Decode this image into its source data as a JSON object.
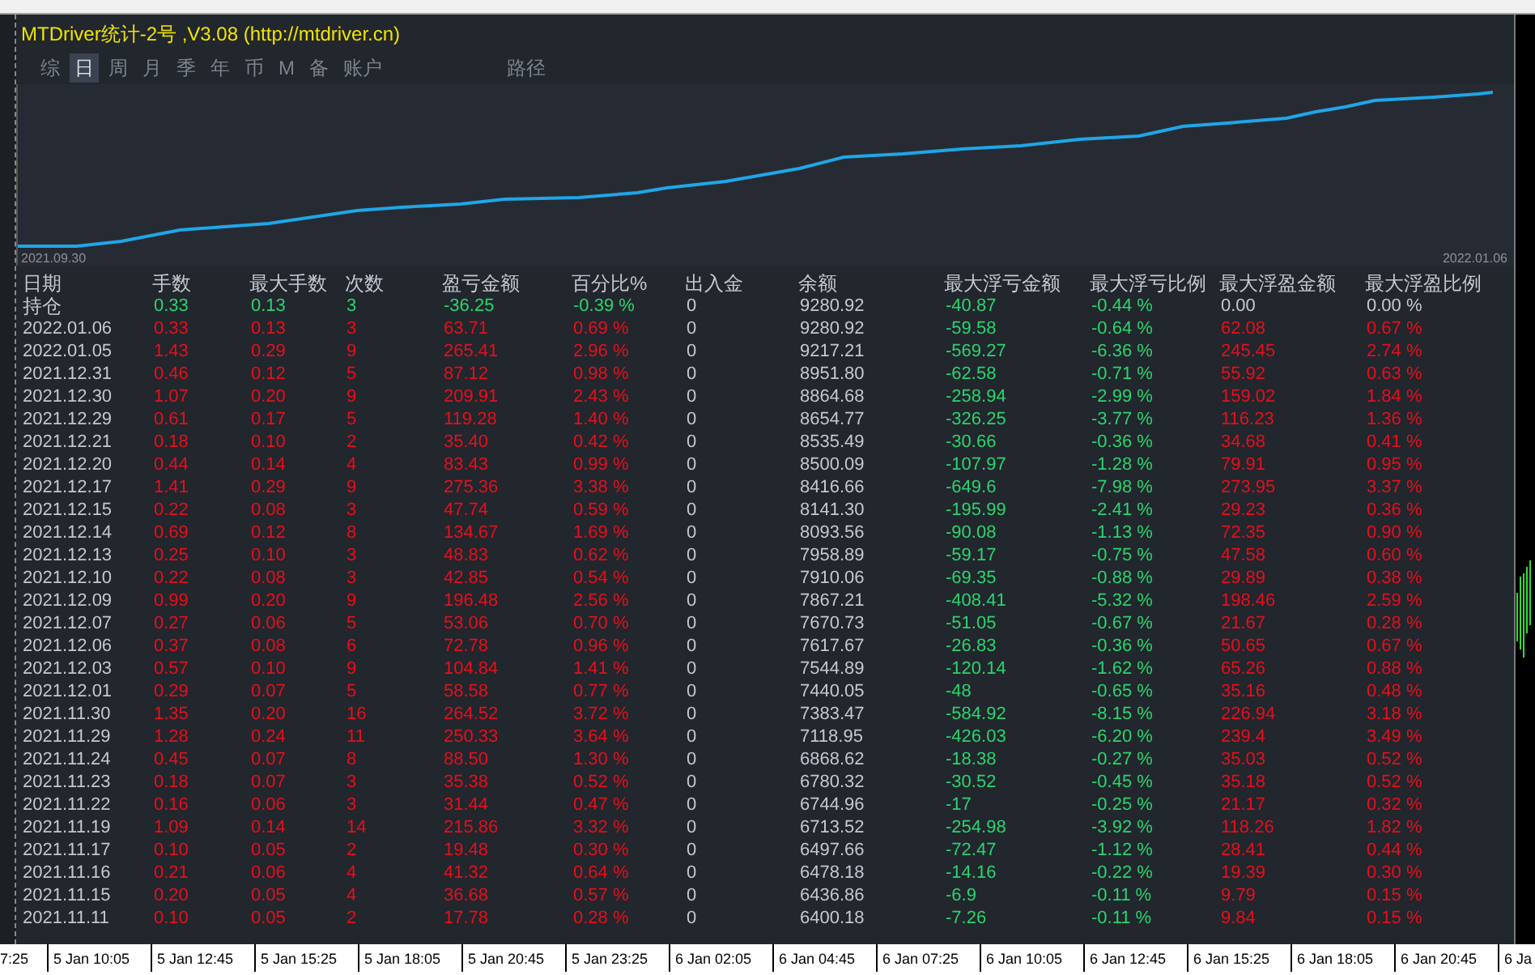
{
  "window": {
    "title": "MTDriver统计-2号 ,V3.08 (http://mtdriver.cn)"
  },
  "tabs": [
    {
      "label": "综",
      "selected": false
    },
    {
      "label": "日",
      "selected": true
    },
    {
      "label": "周",
      "selected": false
    },
    {
      "label": "月",
      "selected": false
    },
    {
      "label": "季",
      "selected": false
    },
    {
      "label": "年",
      "selected": false
    },
    {
      "label": "币",
      "selected": false
    },
    {
      "label": "M",
      "selected": false
    },
    {
      "label": "备",
      "selected": false
    },
    {
      "label": "账户",
      "selected": false
    },
    {
      "label": "路径",
      "selected": false
    }
  ],
  "chart": {
    "start_label": "2021.09.30",
    "end_label": "2022.01.06"
  },
  "table": {
    "columns": [
      "日期",
      "手数",
      "最大手数",
      "次数",
      "盈亏金额",
      "百分比%",
      "出入金",
      "余额",
      "最大浮亏金额",
      "最大浮亏比例",
      "最大浮盈金额",
      "最大浮盈比例"
    ],
    "rows": [
      {
        "kind": "position",
        "cells": [
          "持仓",
          "0.33",
          "0.13",
          "3",
          "-36.25",
          "-0.39 %",
          "0",
          "9280.92",
          "-40.87",
          "-0.44 %",
          "0.00",
          "0.00 %"
        ]
      },
      {
        "kind": "day",
        "cells": [
          "2022.01.06",
          "0.33",
          "0.13",
          "3",
          "63.71",
          "0.69 %",
          "0",
          "9280.92",
          "-59.58",
          "-0.64 %",
          "62.08",
          "0.67 %"
        ]
      },
      {
        "kind": "day",
        "cells": [
          "2022.01.05",
          "1.43",
          "0.29",
          "9",
          "265.41",
          "2.96 %",
          "0",
          "9217.21",
          "-569.27",
          "-6.36 %",
          "245.45",
          "2.74 %"
        ]
      },
      {
        "kind": "day",
        "cells": [
          "2021.12.31",
          "0.46",
          "0.12",
          "5",
          "87.12",
          "0.98 %",
          "0",
          "8951.80",
          "-62.58",
          "-0.71 %",
          "55.92",
          "0.63 %"
        ]
      },
      {
        "kind": "day",
        "cells": [
          "2021.12.30",
          "1.07",
          "0.20",
          "9",
          "209.91",
          "2.43 %",
          "0",
          "8864.68",
          "-258.94",
          "-2.99 %",
          "159.02",
          "1.84 %"
        ]
      },
      {
        "kind": "day",
        "cells": [
          "2021.12.29",
          "0.61",
          "0.17",
          "5",
          "119.28",
          "1.40 %",
          "0",
          "8654.77",
          "-326.25",
          "-3.77 %",
          "116.23",
          "1.36 %"
        ]
      },
      {
        "kind": "day",
        "cells": [
          "2021.12.21",
          "0.18",
          "0.10",
          "2",
          "35.40",
          "0.42 %",
          "0",
          "8535.49",
          "-30.66",
          "-0.36 %",
          "34.68",
          "0.41 %"
        ]
      },
      {
        "kind": "day",
        "cells": [
          "2021.12.20",
          "0.44",
          "0.14",
          "4",
          "83.43",
          "0.99 %",
          "0",
          "8500.09",
          "-107.97",
          "-1.28 %",
          "79.91",
          "0.95 %"
        ]
      },
      {
        "kind": "day",
        "cells": [
          "2021.12.17",
          "1.41",
          "0.29",
          "9",
          "275.36",
          "3.38 %",
          "0",
          "8416.66",
          "-649.6",
          "-7.98 %",
          "273.95",
          "3.37 %"
        ]
      },
      {
        "kind": "day",
        "cells": [
          "2021.12.15",
          "0.22",
          "0.08",
          "3",
          "47.74",
          "0.59 %",
          "0",
          "8141.30",
          "-195.99",
          "-2.41 %",
          "29.23",
          "0.36 %"
        ]
      },
      {
        "kind": "day",
        "cells": [
          "2021.12.14",
          "0.69",
          "0.12",
          "8",
          "134.67",
          "1.69 %",
          "0",
          "8093.56",
          "-90.08",
          "-1.13 %",
          "72.35",
          "0.90 %"
        ]
      },
      {
        "kind": "day",
        "cells": [
          "2021.12.13",
          "0.25",
          "0.10",
          "3",
          "48.83",
          "0.62 %",
          "0",
          "7958.89",
          "-59.17",
          "-0.75 %",
          "47.58",
          "0.60 %"
        ]
      },
      {
        "kind": "day",
        "cells": [
          "2021.12.10",
          "0.22",
          "0.08",
          "3",
          "42.85",
          "0.54 %",
          "0",
          "7910.06",
          "-69.35",
          "-0.88 %",
          "29.89",
          "0.38 %"
        ]
      },
      {
        "kind": "day",
        "cells": [
          "2021.12.09",
          "0.99",
          "0.20",
          "9",
          "196.48",
          "2.56 %",
          "0",
          "7867.21",
          "-408.41",
          "-5.32 %",
          "198.46",
          "2.59 %"
        ]
      },
      {
        "kind": "day",
        "cells": [
          "2021.12.07",
          "0.27",
          "0.06",
          "5",
          "53.06",
          "0.70 %",
          "0",
          "7670.73",
          "-51.05",
          "-0.67 %",
          "21.67",
          "0.28 %"
        ]
      },
      {
        "kind": "day",
        "cells": [
          "2021.12.06",
          "0.37",
          "0.08",
          "6",
          "72.78",
          "0.96 %",
          "0",
          "7617.67",
          "-26.83",
          "-0.36 %",
          "50.65",
          "0.67 %"
        ]
      },
      {
        "kind": "day",
        "cells": [
          "2021.12.03",
          "0.57",
          "0.10",
          "9",
          "104.84",
          "1.41 %",
          "0",
          "7544.89",
          "-120.14",
          "-1.62 %",
          "65.26",
          "0.88 %"
        ]
      },
      {
        "kind": "day",
        "cells": [
          "2021.12.01",
          "0.29",
          "0.07",
          "5",
          "58.58",
          "0.77 %",
          "0",
          "7440.05",
          "-48",
          "-0.65 %",
          "35.16",
          "0.48 %"
        ]
      },
      {
        "kind": "day",
        "cells": [
          "2021.11.30",
          "1.35",
          "0.20",
          "16",
          "264.52",
          "3.72 %",
          "0",
          "7383.47",
          "-584.92",
          "-8.15 %",
          "226.94",
          "3.18 %"
        ]
      },
      {
        "kind": "day",
        "cells": [
          "2021.11.29",
          "1.28",
          "0.24",
          "11",
          "250.33",
          "3.64 %",
          "0",
          "7118.95",
          "-426.03",
          "-6.20 %",
          "239.4",
          "3.49 %"
        ]
      },
      {
        "kind": "day",
        "cells": [
          "2021.11.24",
          "0.45",
          "0.07",
          "8",
          "88.50",
          "1.30 %",
          "0",
          "6868.62",
          "-18.38",
          "-0.27 %",
          "35.03",
          "0.52 %"
        ]
      },
      {
        "kind": "day",
        "cells": [
          "2021.11.23",
          "0.18",
          "0.07",
          "3",
          "35.38",
          "0.52 %",
          "0",
          "6780.32",
          "-30.52",
          "-0.45 %",
          "35.18",
          "0.52 %"
        ]
      },
      {
        "kind": "day",
        "cells": [
          "2021.11.22",
          "0.16",
          "0.06",
          "3",
          "31.44",
          "0.47 %",
          "0",
          "6744.96",
          "-17",
          "-0.25 %",
          "21.17",
          "0.32 %"
        ]
      },
      {
        "kind": "day",
        "cells": [
          "2021.11.19",
          "1.09",
          "0.14",
          "14",
          "215.86",
          "3.32 %",
          "0",
          "6713.52",
          "-254.98",
          "-3.92 %",
          "118.26",
          "1.82 %"
        ]
      },
      {
        "kind": "day",
        "cells": [
          "2021.11.17",
          "0.10",
          "0.05",
          "2",
          "19.48",
          "0.30 %",
          "0",
          "6497.66",
          "-72.47",
          "-1.12 %",
          "28.41",
          "0.44 %"
        ]
      },
      {
        "kind": "day",
        "cells": [
          "2021.11.16",
          "0.21",
          "0.06",
          "4",
          "41.32",
          "0.64 %",
          "0",
          "6478.18",
          "-14.16",
          "-0.22 %",
          "19.39",
          "0.30 %"
        ]
      },
      {
        "kind": "day",
        "cells": [
          "2021.11.15",
          "0.20",
          "0.05",
          "4",
          "36.68",
          "0.57 %",
          "0",
          "6436.86",
          "-6.9",
          "-0.11 %",
          "9.79",
          "0.15 %"
        ]
      },
      {
        "kind": "day",
        "cells": [
          "2021.11.11",
          "0.10",
          "0.05",
          "2",
          "17.78",
          "0.28 %",
          "0",
          "6400.18",
          "-7.26",
          "-0.11 %",
          "9.84",
          "0.15 %"
        ]
      }
    ]
  },
  "time_axis": [
    "7:25",
    "5 Jan 10:05",
    "5 Jan 12:45",
    "5 Jan 15:25",
    "5 Jan 18:05",
    "5 Jan 20:45",
    "5 Jan 23:25",
    "6 Jan 02:05",
    "6 Jan 04:45",
    "6 Jan 07:25",
    "6 Jan 10:05",
    "6 Jan 12:45",
    "6 Jan 15:25",
    "6 Jan 18:05",
    "6 Jan 20:45",
    "6 Ja"
  ]
}
